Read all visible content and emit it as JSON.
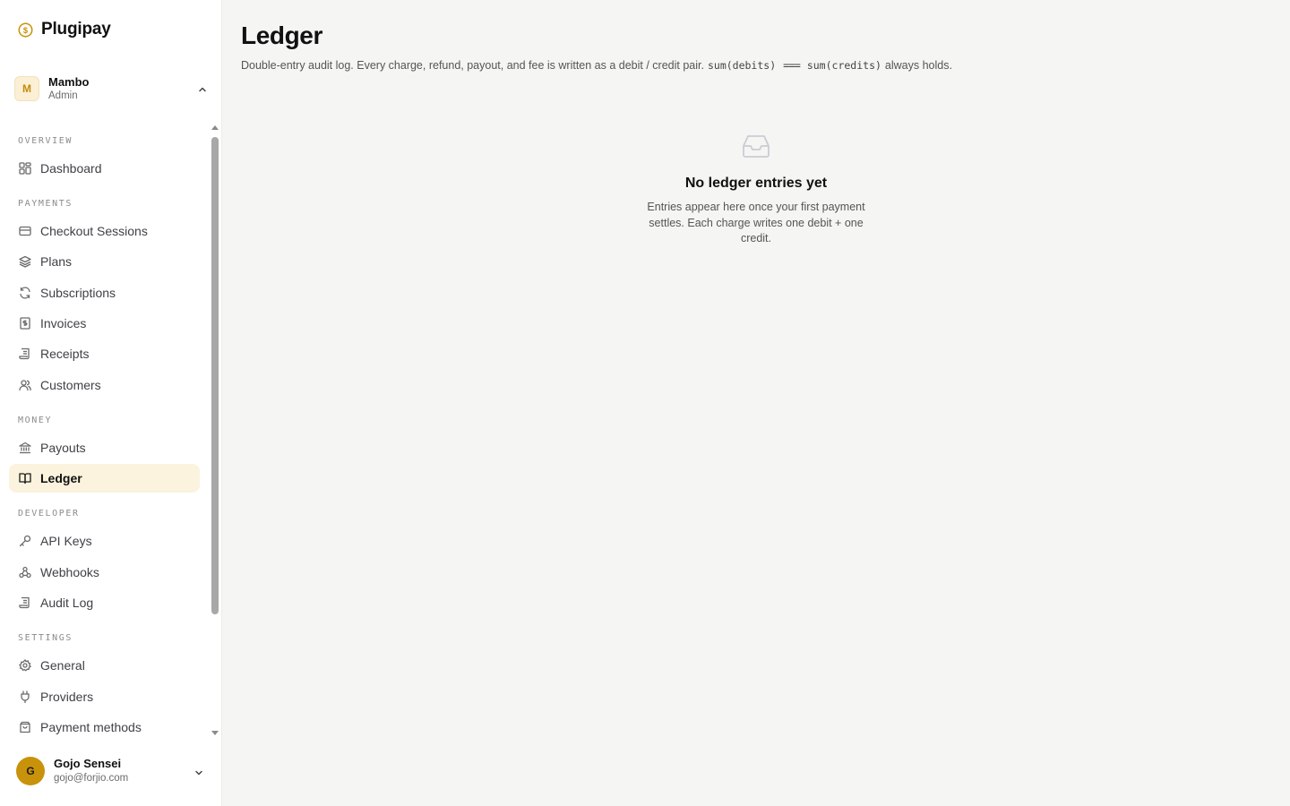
{
  "brand": {
    "name": "Plugipay",
    "accent": "#c8920a"
  },
  "workspace": {
    "initial": "M",
    "name": "Mambo",
    "role": "Admin"
  },
  "sidebar": {
    "sections": [
      {
        "label": "OVERVIEW",
        "items": [
          {
            "label": "Dashboard",
            "icon": "grid-icon"
          }
        ]
      },
      {
        "label": "PAYMENTS",
        "items": [
          {
            "label": "Checkout Sessions",
            "icon": "card-icon"
          },
          {
            "label": "Plans",
            "icon": "layers-icon"
          },
          {
            "label": "Subscriptions",
            "icon": "refresh-icon"
          },
          {
            "label": "Invoices",
            "icon": "invoice-icon"
          },
          {
            "label": "Receipts",
            "icon": "receipt-icon"
          },
          {
            "label": "Customers",
            "icon": "users-icon"
          }
        ]
      },
      {
        "label": "MONEY",
        "items": [
          {
            "label": "Payouts",
            "icon": "bank-icon"
          },
          {
            "label": "Ledger",
            "icon": "book-icon",
            "active": true
          }
        ]
      },
      {
        "label": "DEVELOPER",
        "items": [
          {
            "label": "API Keys",
            "icon": "key-icon"
          },
          {
            "label": "Webhooks",
            "icon": "webhook-icon"
          },
          {
            "label": "Audit Log",
            "icon": "scroll-icon"
          }
        ]
      },
      {
        "label": "SETTINGS",
        "items": [
          {
            "label": "General",
            "icon": "gear-icon"
          },
          {
            "label": "Providers",
            "icon": "plug-icon"
          },
          {
            "label": "Payment methods",
            "icon": "wallet-icon"
          }
        ]
      }
    ]
  },
  "user": {
    "initial": "G",
    "name": "Gojo Sensei",
    "email": "gojo@forjio.com"
  },
  "main": {
    "title": "Ledger",
    "description": {
      "text": "Double-entry audit log. Every charge, refund, payout, and fee is written as a debit / credit pair.",
      "code_left": "sum(debits)",
      "operator": "===",
      "code_right": "sum(credits)",
      "suffix": "always holds."
    },
    "empty_state": {
      "icon": "inbox-icon",
      "title": "No ledger entries yet",
      "text": "Entries appear here once your first payment settles. Each charge writes one debit + one credit."
    }
  }
}
